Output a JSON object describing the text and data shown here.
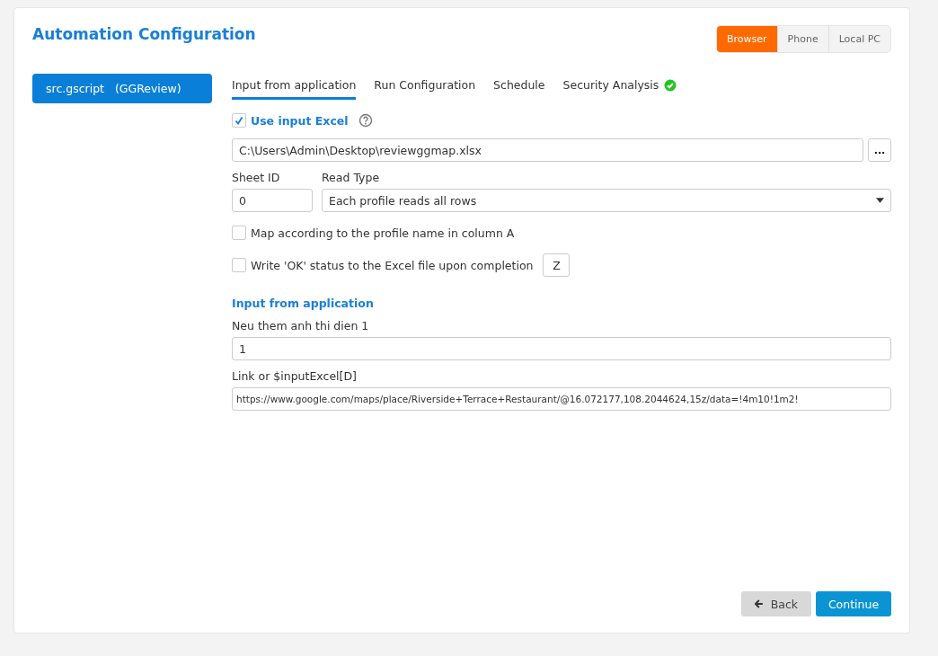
{
  "title": "Automation Configuration",
  "modes": [
    {
      "label": "Browser",
      "selected": true
    },
    {
      "label": "Phone",
      "selected": false
    },
    {
      "label": "Local PC",
      "selected": false
    }
  ],
  "sidebar": {
    "items": [
      {
        "label": "src.gscript   (GGReview)",
        "selected": true
      }
    ]
  },
  "tabs": [
    {
      "label": "Input from application",
      "selected": true,
      "verified": false
    },
    {
      "label": "Run Configuration",
      "selected": false,
      "verified": false
    },
    {
      "label": "Schedule",
      "selected": false,
      "verified": false
    },
    {
      "label": "Security Analysis",
      "selected": false,
      "verified": true
    }
  ],
  "use_excel": {
    "label": "Use input Excel",
    "checked": true
  },
  "file_path": {
    "value": "C:\\Users\\Admin\\Desktop\\reviewggmap.xlsx",
    "browse_label": "..."
  },
  "sheet_id": {
    "label": "Sheet ID",
    "value": "0"
  },
  "read_type": {
    "label": "Read Type",
    "value": "Each profile reads all rows"
  },
  "options": [
    {
      "label": "Map according to the profile name in column A",
      "checked": false
    },
    {
      "label": "Write 'OK' status to the Excel file upon completion",
      "checked": false,
      "column": "Z"
    }
  ],
  "section_title": "Input from application",
  "fields": [
    {
      "label": "Neu them anh thi dien 1",
      "value": "1"
    },
    {
      "label": "Link or $inputExcel[D]",
      "value": "https://www.google.com/maps/place/Riverside+Terrace+Restaurant/@16.072177,108.2044624,15z/data=!4m10!1m2!"
    }
  ],
  "buttons": [
    {
      "label": "Back",
      "kind": "secondary"
    },
    {
      "label": "Continue",
      "kind": "primary"
    }
  ]
}
